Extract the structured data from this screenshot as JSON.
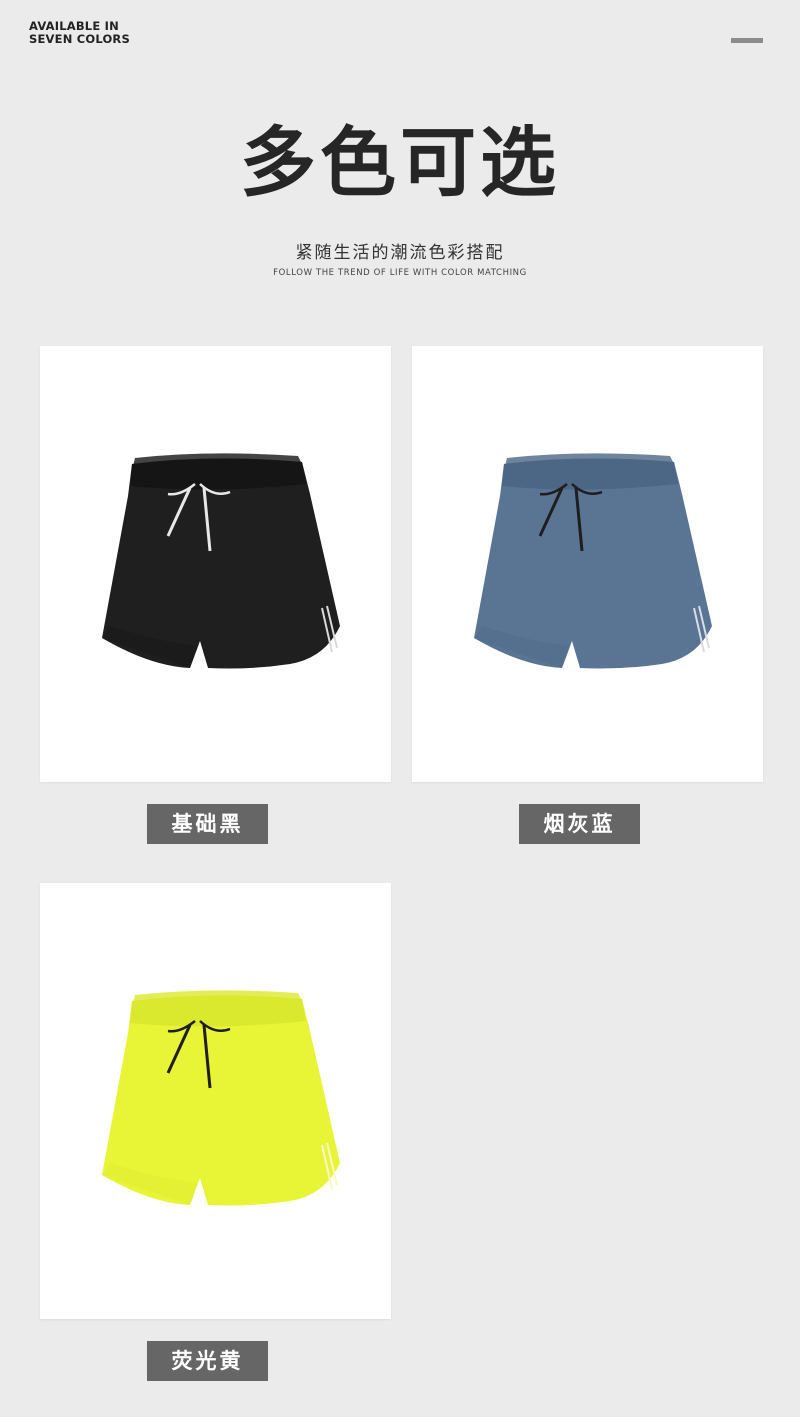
{
  "header": {
    "tagline_line1": "AVAILABLE IN",
    "tagline_line2": "SEVEN COLORS",
    "title": "多色可选",
    "subtitle_cn": "紧随生活的潮流色彩搭配",
    "subtitle_en": "FOLLOW THE TREND OF LIFE WITH COLOR MATCHING"
  },
  "menu_icon": "menu-bar-icon",
  "products": [
    {
      "label": "基础黑",
      "color": "#1f1f1f",
      "waist": "#151515",
      "trim": "#d9d9d9",
      "cord": "#e8e8e8"
    },
    {
      "label": "烟灰蓝",
      "color": "#5a7594",
      "waist": "#4c6785",
      "trim": "#d6dde5",
      "cord": "#1e1e1e"
    },
    {
      "label": "荧光黄",
      "color": "#e8f436",
      "waist": "#dbe92e",
      "trim": "#f7f9c8",
      "cord": "#1e1e1e"
    }
  ]
}
